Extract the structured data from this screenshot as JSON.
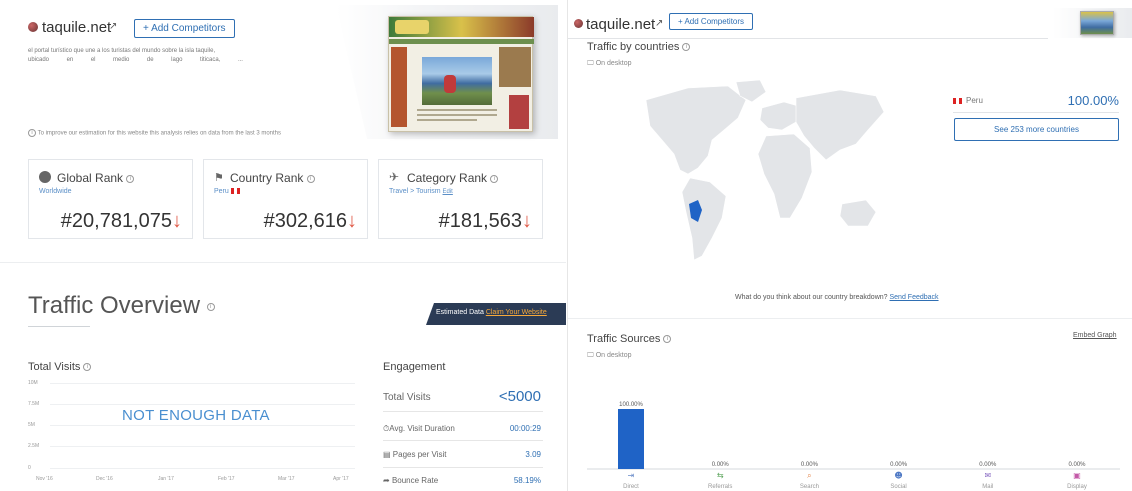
{
  "left": {
    "site": {
      "name": "taquile.net",
      "link_icon": "external-link-icon",
      "add_competitors": "+ Add Competitors"
    },
    "description": {
      "line1": "el portal turístico que une a los turistas del mundo sobre la isla taquile,",
      "line2_words": [
        "ubicado",
        "en",
        "el",
        "medio",
        "de",
        "lago",
        "titicaca,",
        "..."
      ]
    },
    "estimation_note": "To improve our estimation for this website this analysis relies on data from the last 3 months",
    "ranks": [
      {
        "title": "Global Rank",
        "sub": "Worldwide",
        "value": "#20,781,075",
        "icon": "globe-icon"
      },
      {
        "title": "Country Rank",
        "sub": "Peru",
        "value": "#302,616",
        "icon": "flag-icon"
      },
      {
        "title": "Category Rank",
        "sub": "Travel > Tourism",
        "sub_edit": "Edit",
        "value": "#181,563",
        "icon": "plane-icon"
      }
    ],
    "rank_trend_glyph": "↓",
    "overview": {
      "title": "Traffic Overview",
      "estimated": "Estimated Data",
      "claim": "Claim Your Website"
    },
    "total_visits": {
      "title": "Total Visits",
      "message": "NOT ENOUGH DATA",
      "y_ticks": [
        "10M",
        "7.5M",
        "5M",
        "2.5M",
        "0"
      ],
      "x_ticks": [
        "Nov '16",
        "Dec '16",
        "Jan '17",
        "Feb '17",
        "Mar '17",
        "Apr '17"
      ]
    },
    "engagement": {
      "title": "Engagement",
      "total_visits_label": "Total Visits",
      "total_visits_value": "<5000",
      "rows": [
        {
          "label": "Avg. Visit Duration",
          "value": "00:00:29",
          "icon": "clock-icon"
        },
        {
          "label": "Pages per Visit",
          "value": "3.09",
          "icon": "pages-icon"
        },
        {
          "label": "Bounce Rate",
          "value": "58.19%",
          "icon": "bounce-icon"
        }
      ]
    }
  },
  "right": {
    "site": {
      "name": "taquile.net",
      "add_competitors": "+ Add Competitors"
    },
    "countries": {
      "title": "Traffic by countries",
      "device": "On desktop",
      "country": "Peru",
      "share": "100.00%",
      "more_button": "See 253 more countries",
      "feedback_q": "What do you think about our country breakdown?",
      "feedback_link": "Send Feedback"
    },
    "sources": {
      "title": "Traffic Sources",
      "device": "On desktop",
      "embed": "Embed Graph"
    }
  },
  "chart_data": {
    "type": "bar",
    "categories": [
      "Direct",
      "Referrals",
      "Search",
      "Social",
      "Mail",
      "Display"
    ],
    "values": [
      100.0,
      0.0,
      0.0,
      0.0,
      0.0,
      0.0
    ],
    "labels": [
      "100.00%",
      "0.00%",
      "0.00%",
      "0.00%",
      "0.00%",
      "0.00%"
    ],
    "icons": [
      "direct-icon",
      "referrals-icon",
      "search-icon",
      "social-icon",
      "mail-icon",
      "display-icon"
    ],
    "ylim": [
      0,
      100
    ],
    "bar_color": "#1f63c6",
    "icon_colors": [
      "#6a8cc9",
      "#5aa45a",
      "#e58b52",
      "#4d78c4",
      "#8a6cc4",
      "#c45aa8"
    ]
  },
  "colors": {
    "accent": "#2f6fb3",
    "trend_down": "#e05a47",
    "banner": "#2b3b55",
    "claim": "#f7a93a"
  }
}
